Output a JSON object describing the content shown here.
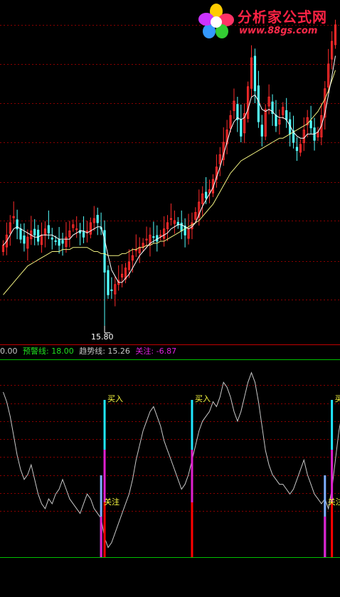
{
  "logo": {
    "title": "分析家公式网",
    "url": "www.88gs.com"
  },
  "colors": {
    "up": "#ff2b2b",
    "down": "#54ffff",
    "ma_short": "#ffffff",
    "ma_long": "#f0f080",
    "grid": "#8a0000",
    "divider": "#c00000",
    "osc": "#c8c8c8",
    "buy_top": "#20e8ff",
    "buy_mid": "#e020d0",
    "buy_low": "#ff0000",
    "label": "#ffff40"
  },
  "price_panel": {
    "low_marker": "15.80",
    "ylim": [
      15.2,
      31.5
    ],
    "gridlines": [
      17.18,
      19.05,
      21.0,
      22.85,
      24.8,
      26.7,
      28.6,
      30.5
    ],
    "close": [
      19.8,
      20.3,
      20.9,
      21.2,
      20.6,
      20.1,
      19.9,
      20.2,
      20.5,
      20.3,
      20.0,
      20.3,
      20.6,
      20.4,
      20.1,
      20.0,
      19.8,
      19.9,
      20.2,
      20.5,
      20.8,
      20.6,
      20.4,
      20.2,
      20.5,
      20.9,
      21.1,
      20.9,
      20.6,
      18.5,
      17.4,
      17.6,
      17.9,
      18.1,
      18.4,
      18.7,
      19.0,
      19.3,
      19.6,
      19.7,
      19.9,
      20.1,
      20.3,
      20.2,
      20.0,
      20.3,
      20.6,
      20.9,
      21.1,
      21.0,
      20.8,
      20.5,
      20.3,
      20.6,
      20.9,
      21.4,
      21.9,
      22.3,
      22.1,
      22.5,
      23.0,
      23.6,
      24.2,
      24.8,
      25.4,
      26.1,
      26.8,
      25.9,
      25.1,
      26.2,
      27.5,
      28.9,
      27.3,
      25.8,
      25.1,
      26.4,
      27.0,
      26.2,
      25.6,
      25.9,
      26.5,
      25.9,
      25.2,
      24.8,
      24.4,
      24.7,
      25.4,
      26.0,
      25.5,
      24.9,
      25.3,
      26.1,
      27.4,
      28.6,
      29.7,
      30.5
    ],
    "ma_short": [
      19.8,
      20.0,
      20.3,
      20.6,
      20.7,
      20.6,
      20.5,
      20.4,
      20.3,
      20.2,
      20.2,
      20.3,
      20.3,
      20.3,
      20.3,
      20.2,
      20.1,
      20.1,
      20.1,
      20.1,
      20.3,
      20.4,
      20.5,
      20.5,
      20.4,
      20.5,
      20.6,
      20.7,
      20.7,
      20.1,
      19.3,
      18.6,
      18.3,
      18.0,
      18.0,
      18.2,
      18.4,
      18.7,
      19.0,
      19.3,
      19.5,
      19.7,
      19.9,
      20.0,
      20.1,
      20.2,
      20.3,
      20.4,
      20.6,
      20.7,
      20.8,
      20.8,
      20.7,
      20.6,
      20.7,
      20.9,
      21.3,
      21.7,
      22.0,
      22.3,
      22.6,
      23.1,
      23.6,
      24.2,
      24.8,
      25.4,
      25.8,
      26.0,
      25.9,
      26.0,
      26.4,
      27.0,
      27.1,
      26.8,
      26.4,
      26.3,
      26.4,
      26.3,
      26.1,
      26.0,
      26.0,
      25.9,
      25.6,
      25.3,
      25.1,
      25.0,
      25.0,
      25.2,
      25.2,
      25.2,
      25.3,
      25.6,
      26.2,
      27.1,
      28.0,
      29.0
    ],
    "ma_long": [
      17.4,
      17.6,
      17.8,
      18.0,
      18.2,
      18.4,
      18.6,
      18.8,
      18.9,
      19.0,
      19.1,
      19.2,
      19.3,
      19.4,
      19.5,
      19.5,
      19.5,
      19.6,
      19.6,
      19.6,
      19.7,
      19.7,
      19.7,
      19.7,
      19.7,
      19.6,
      19.5,
      19.5,
      19.4,
      19.4,
      19.3,
      19.3,
      19.3,
      19.3,
      19.4,
      19.4,
      19.5,
      19.6,
      19.6,
      19.7,
      19.7,
      19.8,
      19.8,
      19.9,
      19.9,
      20.0,
      20.0,
      20.1,
      20.2,
      20.3,
      20.4,
      20.5,
      20.6,
      20.7,
      20.8,
      20.9,
      21.0,
      21.2,
      21.4,
      21.6,
      21.8,
      22.1,
      22.4,
      22.7,
      23.0,
      23.3,
      23.5,
      23.7,
      23.9,
      24.0,
      24.1,
      24.2,
      24.3,
      24.4,
      24.5,
      24.6,
      24.7,
      24.8,
      24.9,
      25.0,
      25.0,
      25.1,
      25.2,
      25.3,
      25.4,
      25.5,
      25.6,
      25.7,
      25.9,
      26.1,
      26.3,
      26.6,
      26.9,
      27.3,
      27.8,
      28.3
    ]
  },
  "indicator_panel": {
    "values": [
      {
        "label": "0.00",
        "color": "#c8c8c8"
      },
      {
        "label": "预警线: 18.00",
        "color": "#20e020"
      },
      {
        "label": "趋势线: 15.26",
        "color": "#c8c8c8"
      },
      {
        "label": "关注: -6.87",
        "color": "#e020e0"
      }
    ],
    "ylim": [
      -8,
      32
    ],
    "gridlines": [
      1.5,
      5.2,
      8.9,
      12.6,
      16.3,
      20.0,
      23.7,
      27.4
    ],
    "osc": [
      26,
      24,
      21,
      17,
      13,
      10,
      8,
      9,
      11,
      8,
      5,
      3,
      2,
      4,
      3,
      5,
      6,
      8,
      6,
      4,
      3,
      2,
      1,
      3,
      5,
      4,
      2,
      1,
      0,
      -4,
      -6,
      -5,
      -3,
      -1,
      1,
      3,
      5,
      8,
      12,
      15,
      18,
      20,
      22,
      23,
      21,
      19,
      16,
      14,
      12,
      10,
      8,
      6,
      7,
      9,
      12,
      15,
      18,
      20,
      21,
      22,
      24,
      23,
      25,
      28,
      27,
      25,
      22,
      20,
      22,
      25,
      28,
      30,
      28,
      24,
      19,
      14,
      11,
      9,
      8,
      7,
      7,
      6,
      5,
      6,
      8,
      10,
      12,
      9,
      7,
      5,
      4,
      3,
      4,
      2,
      6,
      12,
      18,
      22,
      26,
      30
    ],
    "signals": [
      {
        "i": 29,
        "text": "买入",
        "type": "buy"
      },
      {
        "i": 28,
        "text": "关注",
        "type": "watch"
      },
      {
        "i": 54,
        "text": "买入",
        "type": "buy"
      },
      {
        "i": 94,
        "text": "买入",
        "type": "buy"
      },
      {
        "i": 92,
        "text": "关注",
        "type": "watch"
      },
      {
        "i": 103,
        "text": "买入",
        "type": "buy"
      },
      {
        "i": 107,
        "text": "买入",
        "type": "buy"
      }
    ]
  }
}
